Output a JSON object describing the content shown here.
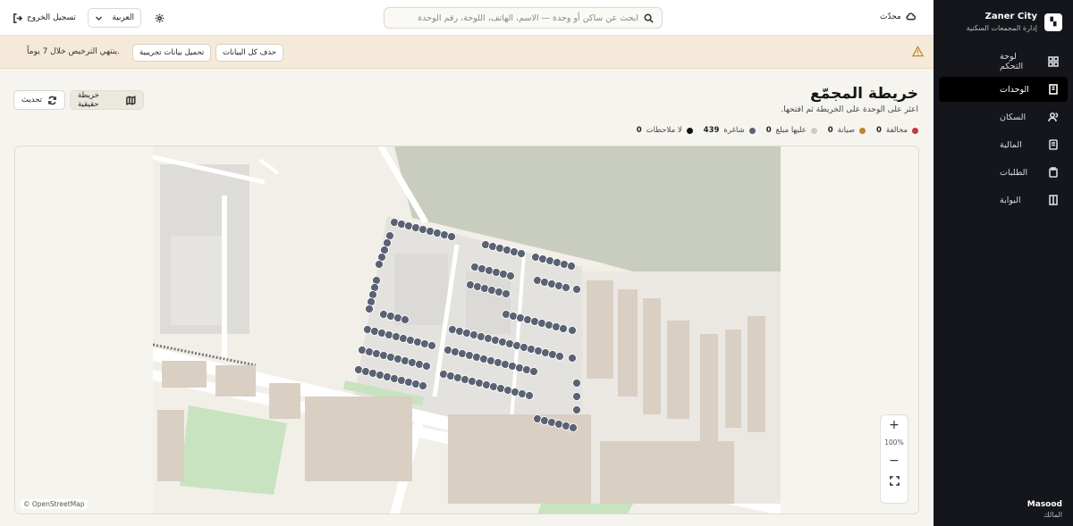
{
  "sidebar": {
    "brand_name": "Zaner City",
    "brand_sub": "إدارة المجمعات السكنية",
    "items": [
      {
        "label": "لوحة التحكم",
        "icon": "dashboard-icon"
      },
      {
        "label": "الوحدات",
        "icon": "building-icon",
        "active": true
      },
      {
        "label": "السكان",
        "icon": "users-icon"
      },
      {
        "label": "المالية",
        "icon": "invoice-icon"
      },
      {
        "label": "الطلبات",
        "icon": "clipboard-icon"
      },
      {
        "label": "البوابة",
        "icon": "gate-icon"
      }
    ],
    "user_name": "Masood",
    "user_role": "المالك"
  },
  "topbar": {
    "logout": "تسجيل الخروج",
    "language": "العربية",
    "search_placeholder": "ابحث عن ساكن أو وحدة — الاسم، الهاتف، اللوحة، رقم الوحدة",
    "updated": "محدّث"
  },
  "warning": {
    "delete_all": "حذف كل البيانات",
    "load_sample": "تحميل بيانات تجريبية",
    "message": ".ينتهي الترخيص خلال 7 يوماً"
  },
  "page": {
    "title": "خريطة المجمّع",
    "subtitle": "اعثر على الوحدة على الخريطة ثم افتحها.",
    "refresh": "تحديث",
    "real_map": "خريطة حقيقية"
  },
  "legend": [
    {
      "label": "مخالفة",
      "count": "0",
      "color": "#c0393b"
    },
    {
      "label": "صيانة",
      "count": "0",
      "color": "#b8862e"
    },
    {
      "label": "عليها مبلغ",
      "count": "0",
      "color": "#cfccc5"
    },
    {
      "label": "شاغرة",
      "count": "439",
      "color": "#5a6274"
    },
    {
      "label": "لا ملاحظات",
      "count": "0",
      "color": "#111111"
    }
  ],
  "map": {
    "zoom_in": "+",
    "zoom_level": "100%",
    "zoom_out": "−",
    "fullscreen": "⛶",
    "attribution": "© OpenStreetMap"
  }
}
